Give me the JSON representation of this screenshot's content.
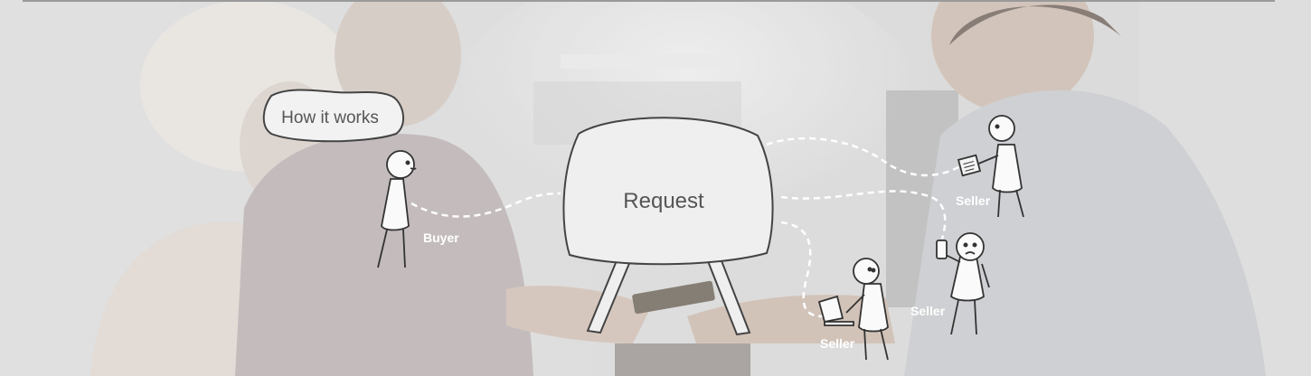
{
  "bubble": {
    "text": "How it works"
  },
  "board": {
    "text": "Request"
  },
  "labels": {
    "buyer": "Buyer",
    "seller_top": "Seller",
    "seller_mid": "Seller",
    "seller_bottom": "Seller"
  },
  "colors": {
    "background": "#d3d3d3",
    "line": "#ffffff",
    "outline": "#444444",
    "text": "#555555"
  },
  "icons": {
    "buyer": "stick-figure-buyer",
    "seller_top": "stick-figure-with-notepad",
    "seller_mid": "stick-figure-with-phone",
    "seller_bottom": "stick-figure-with-laptop"
  }
}
